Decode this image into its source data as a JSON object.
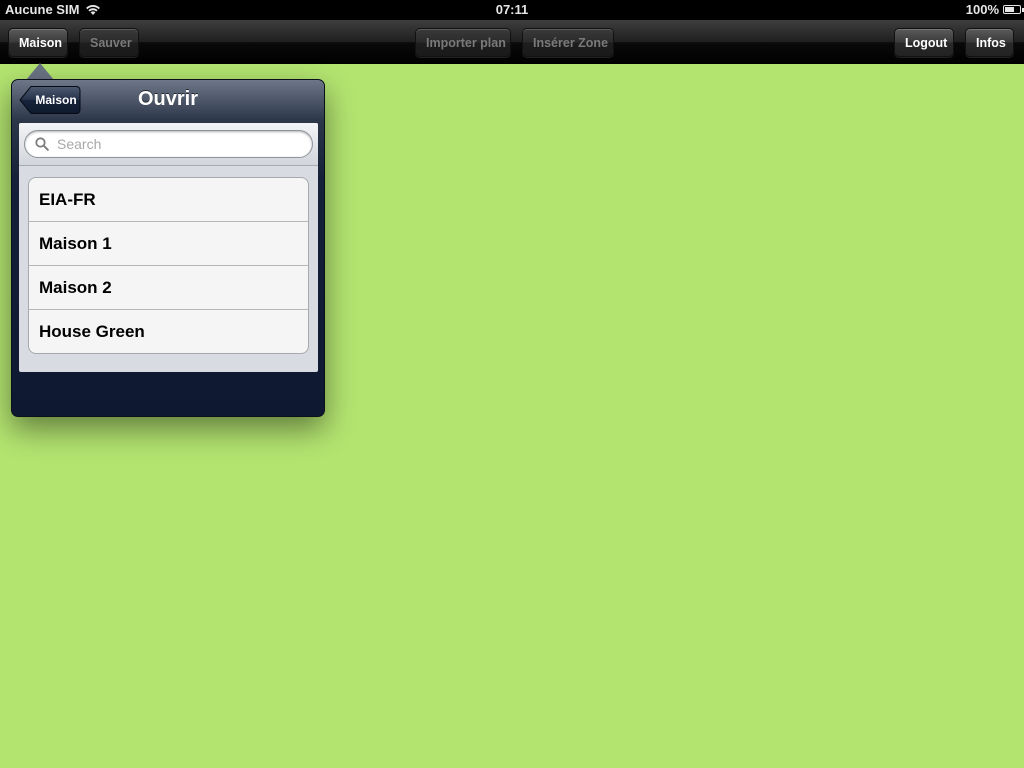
{
  "status_bar": {
    "carrier": "Aucune SIM",
    "time": "07:11",
    "battery": "100%"
  },
  "toolbar": {
    "maison_label": "Maison",
    "sauver_label": "Sauver",
    "importer_label": "Importer plan",
    "inserer_label": "Insérer Zone",
    "logout_label": "Logout",
    "infos_label": "Infos"
  },
  "popover": {
    "back_label": "Maison",
    "title": "Ouvrir",
    "search": {
      "placeholder": "Search",
      "value": ""
    },
    "items": [
      {
        "label": "EIA-FR"
      },
      {
        "label": "Maison 1"
      },
      {
        "label": "Maison 2"
      },
      {
        "label": "House Green"
      }
    ]
  },
  "colors": {
    "background": "#b3e470",
    "toolbar": "#1f1f1f",
    "popover": "#152038"
  }
}
